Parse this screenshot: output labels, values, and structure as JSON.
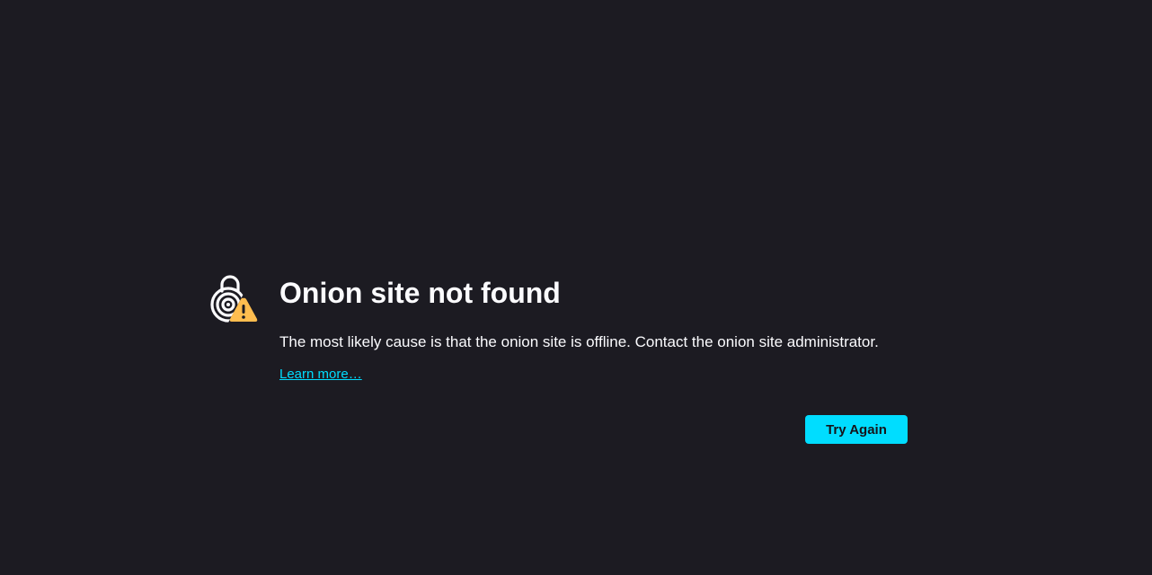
{
  "error": {
    "title": "Onion site not found",
    "description": "The most likely cause is that the onion site is offline. Contact the onion site administrator.",
    "learn_more_label": "Learn more…",
    "try_again_label": "Try Again",
    "icon": "onion-warning-icon"
  },
  "colors": {
    "background": "#1c1b22",
    "text": "#fbfbfe",
    "accent": "#00ddff",
    "warning": "#ffbd4f"
  }
}
